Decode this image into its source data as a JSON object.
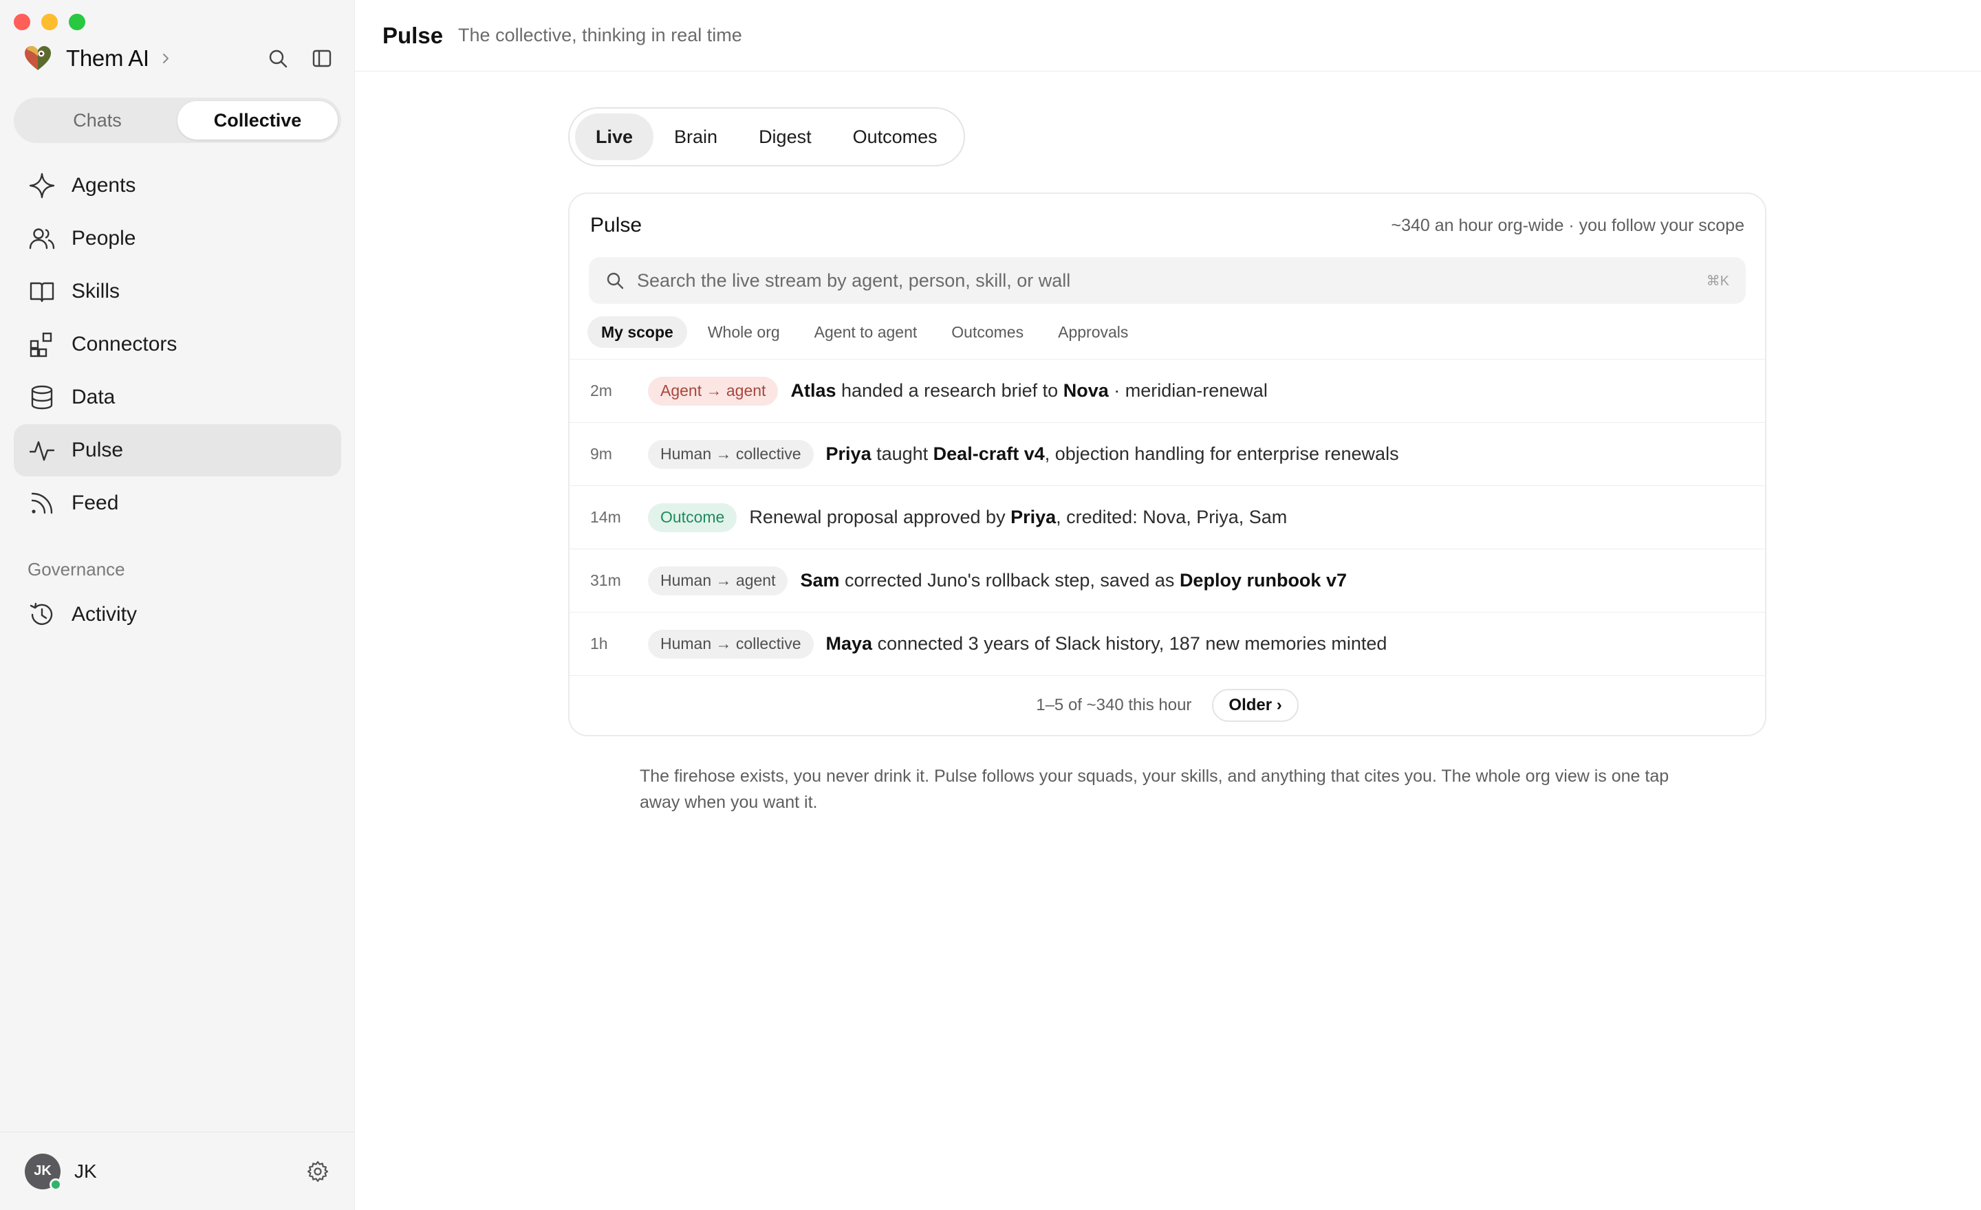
{
  "sidebar": {
    "brand": "Them AI",
    "segments": [
      {
        "label": "Chats",
        "active": false
      },
      {
        "label": "Collective",
        "active": true
      }
    ],
    "nav": [
      {
        "label": "Agents",
        "icon": "sparkle-icon"
      },
      {
        "label": "People",
        "icon": "people-icon"
      },
      {
        "label": "Skills",
        "icon": "book-icon"
      },
      {
        "label": "Connectors",
        "icon": "connectors-icon"
      },
      {
        "label": "Data",
        "icon": "database-icon"
      },
      {
        "label": "Pulse",
        "icon": "pulse-icon",
        "active": true
      },
      {
        "label": "Feed",
        "icon": "rss-icon"
      }
    ],
    "governance_label": "Governance",
    "governance_items": [
      {
        "label": "Activity",
        "icon": "history-icon"
      }
    ],
    "user": {
      "initials": "JK",
      "name": "JK",
      "status_color": "#2fb36d"
    }
  },
  "header": {
    "title": "Pulse",
    "subtitle": "The collective, thinking in real time"
  },
  "tabs": [
    {
      "label": "Live",
      "active": true
    },
    {
      "label": "Brain"
    },
    {
      "label": "Digest"
    },
    {
      "label": "Outcomes"
    }
  ],
  "pulse": {
    "title": "Pulse",
    "meta": "~340 an hour org-wide · you follow your scope",
    "search_placeholder": "Search the live stream by agent, person, skill, or wall",
    "search_shortcut": "⌘K",
    "filters": [
      {
        "label": "My scope",
        "active": true
      },
      {
        "label": "Whole org"
      },
      {
        "label": "Agent to agent"
      },
      {
        "label": "Outcomes"
      },
      {
        "label": "Approvals"
      }
    ],
    "events": [
      {
        "time": "2m",
        "badge": "Agent → agent",
        "badge_kind": "a2a",
        "parts": [
          {
            "t": "Atlas",
            "b": true
          },
          {
            "t": " handed a research brief to "
          },
          {
            "t": "Nova",
            "b": true
          },
          {
            "t": " · meridian-renewal"
          }
        ]
      },
      {
        "time": "9m",
        "badge": "Human → collective",
        "badge_kind": "hc",
        "parts": [
          {
            "t": "Priya",
            "b": true
          },
          {
            "t": " taught "
          },
          {
            "t": "Deal-craft v4",
            "b": true
          },
          {
            "t": ", objection handling for enterprise renewals"
          }
        ]
      },
      {
        "time": "14m",
        "badge": "Outcome",
        "badge_kind": "outcome",
        "parts": [
          {
            "t": "Renewal proposal approved by "
          },
          {
            "t": "Priya",
            "b": true
          },
          {
            "t": ", credited: Nova, Priya, Sam"
          }
        ]
      },
      {
        "time": "31m",
        "badge": "Human → agent",
        "badge_kind": "hc",
        "parts": [
          {
            "t": "Sam",
            "b": true
          },
          {
            "t": " corrected Juno's rollback step, saved as "
          },
          {
            "t": "Deploy runbook v7",
            "b": true
          }
        ]
      },
      {
        "time": "1h",
        "badge": "Human → collective",
        "badge_kind": "hc",
        "parts": [
          {
            "t": "Maya",
            "b": true
          },
          {
            "t": " connected 3 years of Slack history, 187 new memories minted"
          }
        ]
      }
    ],
    "footer_count": "1–5 of ~340 this hour",
    "older_label": "Older ›"
  },
  "footnote": "The firehose exists, you never drink it. Pulse follows your squads, your skills, and anything that cites you. The whole org view is one tap away when you want it.",
  "colors": {
    "a2a_badge_bg": "#fbe6e4",
    "a2a_badge_fg": "#a7473d",
    "outcome_badge_bg": "#e2f3ec",
    "outcome_badge_fg": "#1f8a5b",
    "sidebar_bg": "#f5f5f5"
  }
}
